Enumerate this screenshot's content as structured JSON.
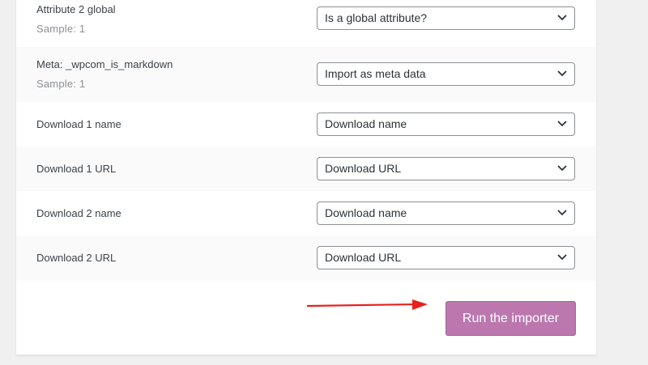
{
  "rows": [
    {
      "label": "Attribute 2 global",
      "sample": "Sample: 1",
      "selected": "Is a global attribute?"
    },
    {
      "label": "Meta: _wpcom_is_markdown",
      "sample": "Sample: 1",
      "selected": "Import as meta data"
    },
    {
      "label": "Download 1 name",
      "selected": "Download name"
    },
    {
      "label": "Download 1 URL",
      "selected": "Download URL"
    },
    {
      "label": "Download 2 name",
      "selected": "Download name"
    },
    {
      "label": "Download 2 URL",
      "selected": "Download URL"
    }
  ],
  "footer": {
    "run_label": "Run the importer"
  },
  "colors": {
    "button": "#bb77ae",
    "arrow": "#e8201b"
  },
  "icons": {
    "select_chevron": "chevron-down-icon",
    "annotation": "red-arrow-icon"
  }
}
